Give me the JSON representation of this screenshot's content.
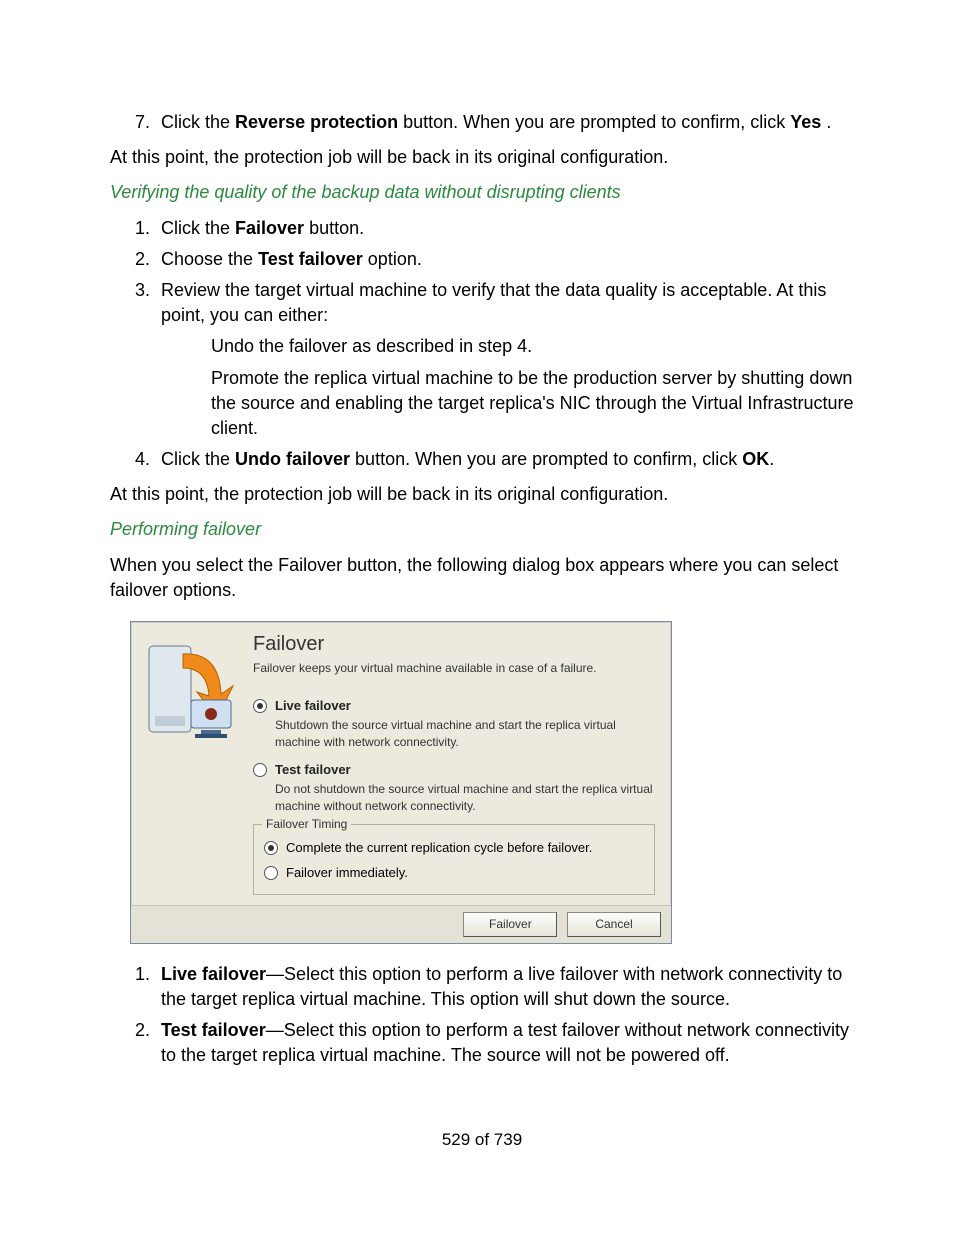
{
  "step7": {
    "prefix": "Click the ",
    "bold": "Reverse protection",
    "mid": " button. When you are prompted to confirm, click ",
    "bold2": "Yes",
    "suffix": " ."
  },
  "after7": "At this point, the protection job will be back in its original configuration.",
  "heading1": "Verifying the quality of the backup data without disrupting clients",
  "list2": {
    "s1": {
      "prefix": "Click the ",
      "bold": "Failover",
      "suffix": " button."
    },
    "s2": {
      "prefix": "Choose the ",
      "bold": "Test failover",
      "suffix": " option."
    },
    "s3": "Review the target virtual machine to verify that the data quality is acceptable. At this point, you can either:",
    "s3a": "Undo the failover as described in step 4.",
    "s3b": "Promote the replica virtual machine to be the production server by shutting down the source and enabling the target replica's NIC through the Virtual Infrastructure client.",
    "s4": {
      "prefix": "Click the ",
      "bold": "Undo failover",
      "mid": " button. When you are prompted to confirm, click ",
      "bold2": "OK",
      "suffix": "."
    }
  },
  "after4": "At this point, the protection job will be back in its original configuration.",
  "heading2": "Performing failover",
  "intro2": "When you select the Failover button, the following dialog box appears where you can select failover options.",
  "dialog": {
    "title": "Failover",
    "subtitle": "Failover keeps your virtual machine available in case of a failure.",
    "opt1": {
      "label": "Live failover",
      "desc": "Shutdown the source virtual machine and start the replica virtual machine with network connectivity.",
      "selected": true
    },
    "opt2": {
      "label": "Test failover",
      "desc": "Do not shutdown the source virtual machine and start the replica virtual machine without network connectivity.",
      "selected": false
    },
    "timing": {
      "legend": "Failover Timing",
      "t1": {
        "label": "Complete the current replication cycle before failover.",
        "selected": true
      },
      "t2": {
        "label": "Failover immediately.",
        "selected": false
      }
    },
    "buttons": {
      "ok": "Failover",
      "cancel": "Cancel"
    }
  },
  "list3": {
    "s1": {
      "bold": "Live failover",
      "text": "—Select this option to perform a live failover with network connectivity to the target replica virtual machine. This option will shut down the source."
    },
    "s2": {
      "bold": "Test failover",
      "text": "—Select this option to perform a test failover without network connectivity to the target replica virtual machine. The source will not be powered off."
    }
  },
  "pagenum": "529 of 739"
}
